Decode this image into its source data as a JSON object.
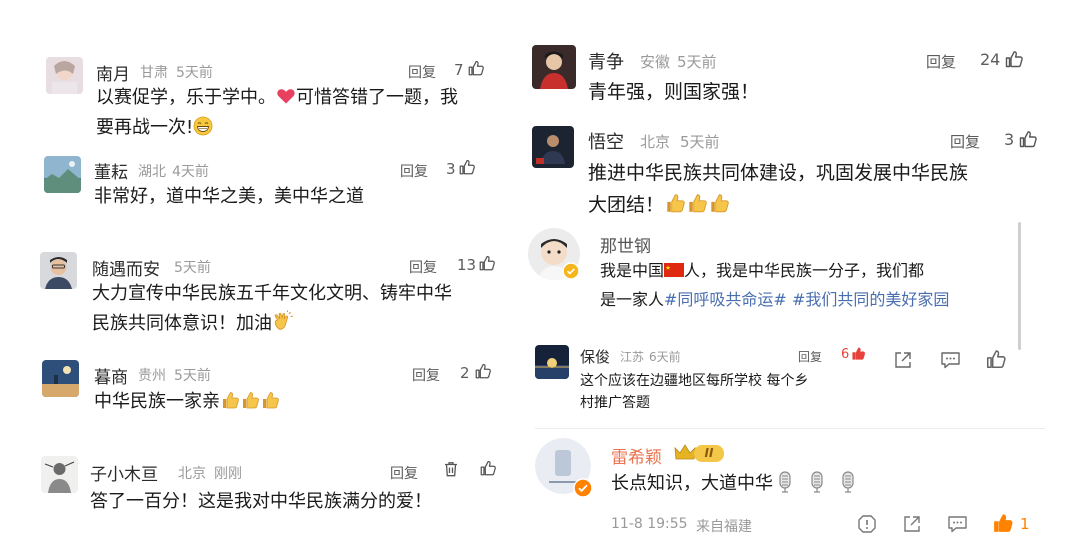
{
  "left": [
    {
      "user": "南月",
      "location": "甘肃",
      "time": "5天前",
      "reply": "回复",
      "likes": "7",
      "text1": "以赛促学，乐于学中。",
      "text2": "可惜答错了一题，我",
      "text3": "要再战一次!"
    },
    {
      "user": "董耘",
      "location": "湖北",
      "time": "4天前",
      "reply": "回复",
      "likes": "3",
      "text1": "非常好，道中华之美，美中华之道"
    },
    {
      "user": "随遇而安",
      "time": "5天前",
      "reply": "回复",
      "likes": "13",
      "text1": "大力宣传中华民族五千年文化文明、铸牢中华",
      "text2": "民族共同体意识！加油"
    },
    {
      "user": "暮商",
      "location": "贵州",
      "time": "5天前",
      "reply": "回复",
      "likes": "2",
      "text1": "中华民族一家亲"
    },
    {
      "user": "子小木亘",
      "location": "北京",
      "time": "刚刚",
      "reply": "回复",
      "text1": "答了一百分！这是我对中华民族满分的爱！"
    }
  ],
  "right": {
    "c1": {
      "user": "青争",
      "location": "安徽",
      "time": "5天前",
      "reply": "回复",
      "likes": "24",
      "text1": "青年强，则国家强！"
    },
    "c2": {
      "user": "悟空",
      "location": "北京",
      "time": "5天前",
      "reply": "回复",
      "likes": "3",
      "text1": "推进中华民族共同体建设，巩固发展中华民族",
      "text2": "大团结！"
    },
    "c3": {
      "user": "那世钢",
      "text1a": "我是中国",
      "text1b": "人，我是中华民族一分子，我们都",
      "text2a": "是一家人",
      "tag1": "#同呼吸共命运#",
      "tag2": "#我们共同的美好家园"
    },
    "c4": {
      "user": "保俊",
      "location": "江苏",
      "time": "6天前",
      "reply": "回复",
      "likes": "6",
      "text1": "这个应该在边疆地区每所学校  每个乡",
      "text2": "村推广答题"
    },
    "c5": {
      "user": "雷希颖",
      "badge": "II",
      "text1": "长点知识，大道中华",
      "datetime": "11-8 19:55",
      "source": "来自福建",
      "likes": "1"
    }
  },
  "colors": {
    "accent_orange": "#ff8200",
    "hashtag_blue": "#4a6fb0",
    "like_red": "#e8413a",
    "gold": "#e6b422"
  }
}
